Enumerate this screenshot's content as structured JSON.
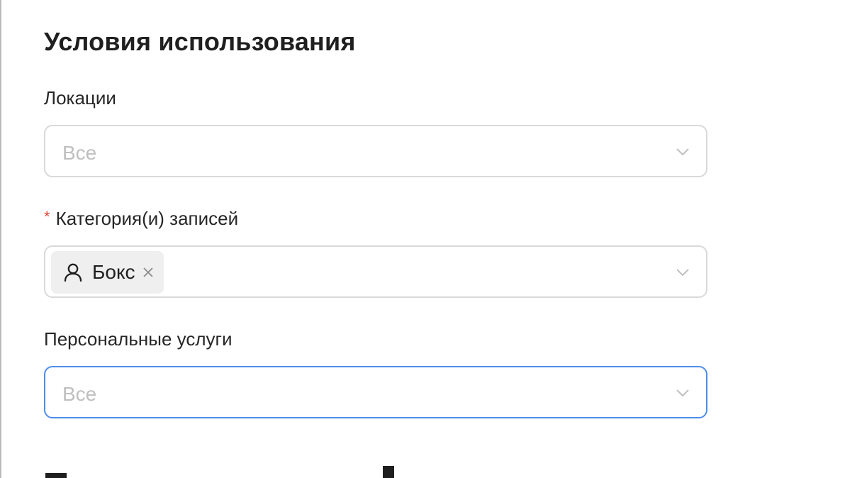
{
  "section": {
    "title": "Условия использования"
  },
  "fields": {
    "locations": {
      "label": "Локации",
      "placeholder": "Все"
    },
    "categories": {
      "required_mark": "*",
      "label": "Категория(и) записей",
      "selected_tags": [
        {
          "label": "Бокс",
          "icon": "user-icon"
        }
      ]
    },
    "personal_services": {
      "label": "Персональные услуги",
      "placeholder": "Все"
    }
  },
  "colors": {
    "required": "#e0463a",
    "focus_border": "#4e8cec",
    "border": "#d9d9d9",
    "placeholder": "#bfbfbf",
    "tag_bg": "#efefef"
  }
}
